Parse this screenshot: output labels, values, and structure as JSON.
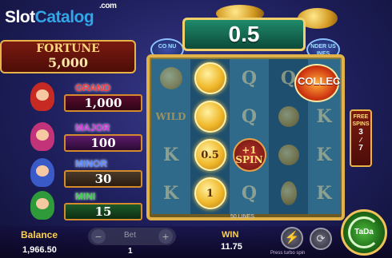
{
  "logo": {
    "part1": "Slot",
    "part2": "Catalog",
    "suffix": ".com"
  },
  "fortune": {
    "label": "FORTUNE",
    "value": "5,000"
  },
  "jackpots": [
    {
      "label": "GRAND",
      "value": "1,000"
    },
    {
      "label": "MAJOR",
      "value": "100"
    },
    {
      "label": "MINOR",
      "value": "30"
    },
    {
      "label": "MINI",
      "value": "15"
    }
  ],
  "win_display": "0.5",
  "feature_labels": {
    "left": "CO NU",
    "right": "NDER US INES"
  },
  "reels": {
    "columns": [
      [
        "K",
        "coin-blank",
        "K",
        "K"
      ],
      [
        "coin-blank",
        "0.5",
        "1",
        ""
      ],
      [
        "Q",
        "Q",
        "+1 SPIN",
        "Q"
      ],
      [
        "Q",
        "K",
        "K",
        "Q"
      ],
      [
        "K",
        "K",
        "K",
        "K"
      ]
    ],
    "coin_labels": {
      "top": "",
      "mid": "0.5",
      "low": "1"
    },
    "spin_label": "+1 SPIN",
    "wild_label": "WILD",
    "lines_label": "50 LINES"
  },
  "collect_label": "COLLEC",
  "free_spins": {
    "label": "FREE SPINS",
    "current": "3",
    "total": "7"
  },
  "bottom": {
    "balance_label": "Balance",
    "balance_value": "1,966.50",
    "bet_label": "Bet",
    "bet_value": "1",
    "win_label": "WIN",
    "win_value": "11.75",
    "turbo_hint": "Press turbo spin",
    "spin_label": "TaDa"
  },
  "colors": {
    "gold": "#ffd24a",
    "accent_green": "#1f8a6a",
    "reel_blue": "#2f6a8a"
  }
}
